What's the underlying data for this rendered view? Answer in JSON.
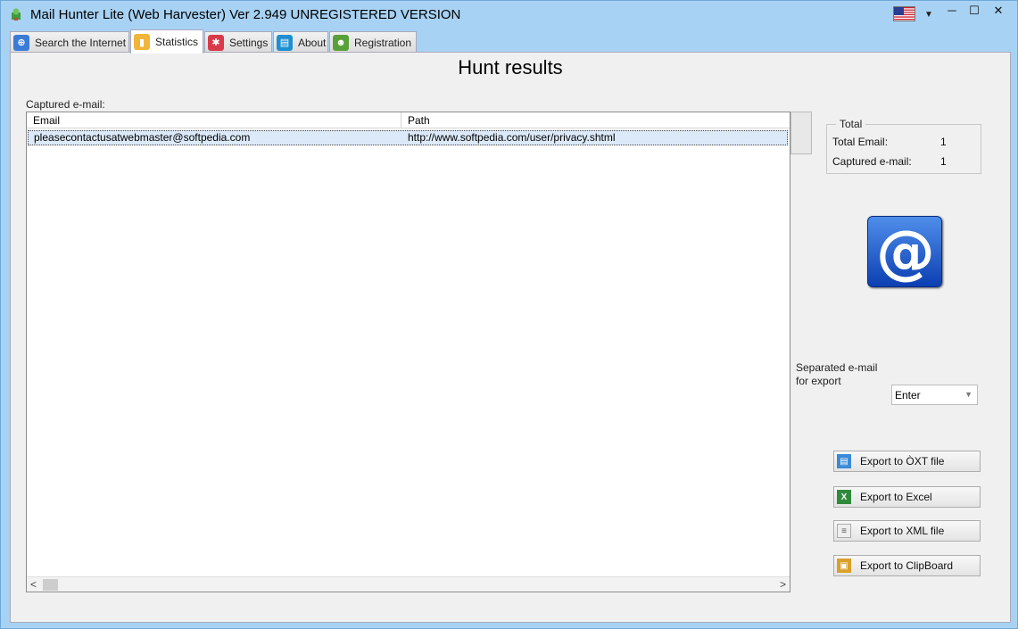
{
  "window": {
    "title": "Mail Hunter Lite (Web Harvester)  Ver 2.949   UNREGISTERED VERSION",
    "minimize_symbol": "─",
    "maximize_symbol": "☐",
    "close_symbol": "✕",
    "dropdown_symbol": "▼"
  },
  "tabs": [
    {
      "label": "Search the Internet",
      "icon": "globe-icon"
    },
    {
      "label": "Statistics",
      "icon": "statistics-icon"
    },
    {
      "label": "Settings",
      "icon": "gear-icon"
    },
    {
      "label": "About",
      "icon": "book-icon"
    },
    {
      "label": "Registration",
      "icon": "user-icon"
    }
  ],
  "main": {
    "title": "Hunt results",
    "captured_label": "Captured e-mail:",
    "table": {
      "columns": [
        "Email",
        "Path"
      ],
      "rows": [
        {
          "email": "pleasecontactusatwebmaster@softpedia.com",
          "path": "http://www.softpedia.com/user/privacy.shtml"
        }
      ],
      "scroll_left": "<",
      "scroll_right": ">"
    }
  },
  "total": {
    "legend": "Total",
    "total_email_label": "Total Email:",
    "total_email_value": "1",
    "captured_label": "Captured e-mail:",
    "captured_value": "1"
  },
  "logo_symbol": "@",
  "separator": {
    "label_line1": "Separated e-mail",
    "label_line2": "for export",
    "selected": "Enter"
  },
  "export": {
    "txt": "Export to ÒXT file",
    "excel": "Export to Excel",
    "xml": "Export to XML file",
    "clipboard": "Export to ClipBoard"
  }
}
